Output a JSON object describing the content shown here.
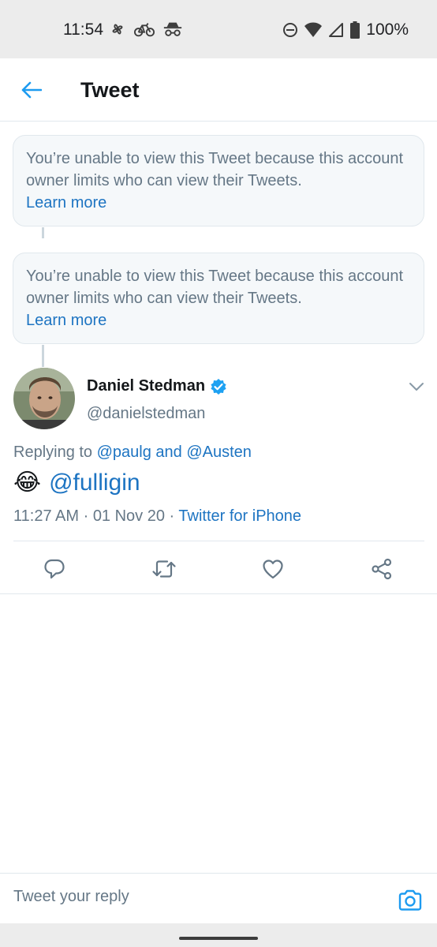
{
  "status_bar": {
    "time": "11:54",
    "battery": "100%",
    "left_icons": [
      "pinwheel-icon",
      "bicycle-icon",
      "incognito-icon"
    ],
    "right_icons": [
      "do-not-disturb-icon",
      "wifi-icon",
      "signal-icon",
      "battery-icon"
    ]
  },
  "header": {
    "title": "Tweet",
    "back_icon": "arrow-left-icon"
  },
  "unavailable": [
    {
      "message": "You’re unable to view this Tweet because this account owner limits who can view their Tweets.",
      "link": "Learn more"
    },
    {
      "message": "You’re unable to view this Tweet because this account owner limits who can view their Tweets.",
      "link": "Learn more"
    }
  ],
  "tweet": {
    "author_name": "Daniel Stedman",
    "handle": "@danielstedman",
    "verified_icon": "verified-badge-icon",
    "replying_prefix": "Replying to ",
    "replying_user1": "@paulg",
    "replying_and": " and ",
    "replying_user2": "@Austen",
    "emoji": "😂",
    "mention": "@fulligin",
    "time": "11:27 AM",
    "separator": " · ",
    "date": "01 Nov 20",
    "source": "Twitter for iPhone"
  },
  "actions": [
    "reply-icon",
    "retweet-icon",
    "like-icon",
    "share-icon"
  ],
  "colors": {
    "accent": "#1d74c2",
    "secondary_text": "#657786",
    "border": "#e1e8ed",
    "card_bg": "#f5f8fa",
    "verified": "#1da1f2"
  },
  "reply_bar": {
    "placeholder": "Tweet your reply",
    "camera_icon": "camera-icon"
  }
}
